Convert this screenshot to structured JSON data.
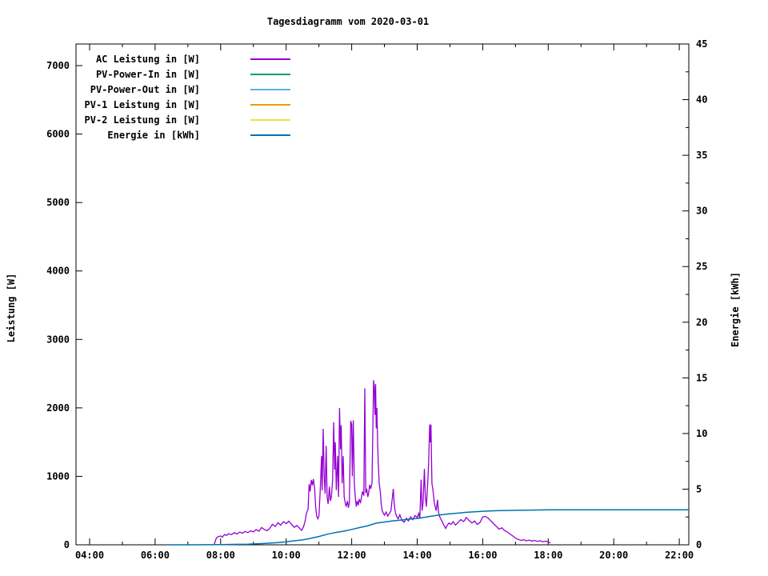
{
  "title": "Tagesdiagramm vom 2020-03-01",
  "colors": {
    "background": "#ffffff",
    "border": "#000000",
    "text": "#000000"
  },
  "axes": {
    "y_left": {
      "label": "Leistung [W]",
      "major": [
        {
          "v": 0,
          "label": "0"
        },
        {
          "v": 1000,
          "label": "1000"
        },
        {
          "v": 2000,
          "label": "2000"
        },
        {
          "v": 3000,
          "label": "3000"
        },
        {
          "v": 4000,
          "label": "4000"
        },
        {
          "v": 5000,
          "label": "5000"
        },
        {
          "v": 6000,
          "label": "6000"
        },
        {
          "v": 7000,
          "label": "7000"
        }
      ],
      "range": [
        0,
        7315
      ]
    },
    "y_right": {
      "label": "Energie [kWh]",
      "major": [
        {
          "v": 0,
          "label": "0"
        },
        {
          "v": 5,
          "label": "5"
        },
        {
          "v": 10,
          "label": "10"
        },
        {
          "v": 15,
          "label": "15"
        },
        {
          "v": 20,
          "label": "20"
        },
        {
          "v": 25,
          "label": "25"
        },
        {
          "v": 30,
          "label": "30"
        },
        {
          "v": 35,
          "label": "35"
        },
        {
          "v": 40,
          "label": "40"
        },
        {
          "v": 45,
          "label": "45"
        }
      ],
      "minor": [
        2.5,
        7.5,
        12.5,
        17.5,
        22.5,
        27.5,
        32.5,
        37.5,
        42.5
      ],
      "range": [
        0,
        45
      ]
    },
    "x": {
      "major": [
        {
          "h": 4,
          "label": "04:00"
        },
        {
          "h": 6,
          "label": "06:00"
        },
        {
          "h": 8,
          "label": "08:00"
        },
        {
          "h": 10,
          "label": "10:00"
        },
        {
          "h": 12,
          "label": "12:00"
        },
        {
          "h": 14,
          "label": "14:00"
        },
        {
          "h": 16,
          "label": "16:00"
        },
        {
          "h": 18,
          "label": "18:00"
        },
        {
          "h": 20,
          "label": "20:00"
        },
        {
          "h": 22,
          "label": "22:00"
        }
      ],
      "minor": [
        5,
        7,
        9,
        11,
        13,
        15,
        17,
        19,
        21
      ],
      "range_hours": [
        3.59,
        22.3
      ]
    }
  },
  "chart_data": {
    "type": "line",
    "title": "Tagesdiagramm vom 2020-03-01",
    "xlabel": "",
    "x_unit": "time of day (hours)",
    "legend_position": "top-left-inside",
    "grid": false,
    "series": [
      {
        "name": "AC Leistung in [W]",
        "color": "#9400d3",
        "axis": "left",
        "width": 1.3,
        "points": [
          [
            7.8,
            0
          ],
          [
            7.83,
            45
          ],
          [
            7.87,
            100
          ],
          [
            7.93,
            120
          ],
          [
            8.0,
            130
          ],
          [
            8.05,
            112
          ],
          [
            8.12,
            150
          ],
          [
            8.18,
            138
          ],
          [
            8.25,
            162
          ],
          [
            8.33,
            148
          ],
          [
            8.42,
            176
          ],
          [
            8.5,
            158
          ],
          [
            8.58,
            186
          ],
          [
            8.67,
            170
          ],
          [
            8.75,
            196
          ],
          [
            8.83,
            178
          ],
          [
            8.92,
            205
          ],
          [
            9.0,
            188
          ],
          [
            9.08,
            222
          ],
          [
            9.17,
            200
          ],
          [
            9.25,
            252
          ],
          [
            9.33,
            224
          ],
          [
            9.42,
            206
          ],
          [
            9.5,
            242
          ],
          [
            9.58,
            300
          ],
          [
            9.67,
            268
          ],
          [
            9.75,
            322
          ],
          [
            9.83,
            288
          ],
          [
            9.92,
            338
          ],
          [
            10.0,
            308
          ],
          [
            10.08,
            345
          ],
          [
            10.17,
            294
          ],
          [
            10.25,
            256
          ],
          [
            10.33,
            282
          ],
          [
            10.42,
            236
          ],
          [
            10.47,
            212
          ],
          [
            10.53,
            262
          ],
          [
            10.58,
            352
          ],
          [
            10.62,
            462
          ],
          [
            10.67,
            520
          ],
          [
            10.7,
            888
          ],
          [
            10.73,
            778
          ],
          [
            10.77,
            948
          ],
          [
            10.8,
            868
          ],
          [
            10.83,
            962
          ],
          [
            10.87,
            820
          ],
          [
            10.9,
            556
          ],
          [
            10.93,
            420
          ],
          [
            10.97,
            380
          ],
          [
            11.0,
            424
          ],
          [
            11.05,
            896
          ],
          [
            11.08,
            1296
          ],
          [
            11.1,
            796
          ],
          [
            11.13,
            1694
          ],
          [
            11.16,
            1002
          ],
          [
            11.19,
            748
          ],
          [
            11.22,
            1446
          ],
          [
            11.25,
            700
          ],
          [
            11.28,
            598
          ],
          [
            11.32,
            848
          ],
          [
            11.35,
            640
          ],
          [
            11.38,
            702
          ],
          [
            11.42,
            948
          ],
          [
            11.45,
            1790
          ],
          [
            11.48,
            1096
          ],
          [
            11.5,
            1498
          ],
          [
            11.53,
            798
          ],
          [
            11.57,
            1298
          ],
          [
            11.6,
            700
          ],
          [
            11.63,
            1998
          ],
          [
            11.66,
            1396
          ],
          [
            11.68,
            1748
          ],
          [
            11.71,
            898
          ],
          [
            11.74,
            1296
          ],
          [
            11.77,
            700
          ],
          [
            11.8,
            618
          ],
          [
            11.83,
            558
          ],
          [
            11.87,
            642
          ],
          [
            11.9,
            540
          ],
          [
            11.93,
            618
          ],
          [
            11.97,
            1810
          ],
          [
            12.0,
            1756
          ],
          [
            12.02,
            1000
          ],
          [
            12.05,
            1818
          ],
          [
            12.08,
            896
          ],
          [
            12.11,
            700
          ],
          [
            12.14,
            558
          ],
          [
            12.17,
            640
          ],
          [
            12.2,
            578
          ],
          [
            12.23,
            660
          ],
          [
            12.27,
            618
          ],
          [
            12.3,
            700
          ],
          [
            12.33,
            778
          ],
          [
            12.37,
            718
          ],
          [
            12.4,
            2286
          ],
          [
            12.43,
            758
          ],
          [
            12.46,
            820
          ],
          [
            12.49,
            700
          ],
          [
            12.52,
            758
          ],
          [
            12.55,
            878
          ],
          [
            12.58,
            818
          ],
          [
            12.62,
            898
          ],
          [
            12.65,
            1798
          ],
          [
            12.67,
            2404
          ],
          [
            12.69,
            2300
          ],
          [
            12.71,
            1898
          ],
          [
            12.73,
            2348
          ],
          [
            12.75,
            1700
          ],
          [
            12.77,
            1998
          ],
          [
            12.79,
            1498
          ],
          [
            12.81,
            1196
          ],
          [
            12.84,
            898
          ],
          [
            12.87,
            798
          ],
          [
            12.9,
            598
          ],
          [
            12.93,
            498
          ],
          [
            12.97,
            458
          ],
          [
            13.0,
            432
          ],
          [
            13.05,
            478
          ],
          [
            13.1,
            420
          ],
          [
            13.15,
            458
          ],
          [
            13.2,
            498
          ],
          [
            13.27,
            816
          ],
          [
            13.3,
            598
          ],
          [
            13.33,
            478
          ],
          [
            13.37,
            420
          ],
          [
            13.42,
            380
          ],
          [
            13.47,
            438
          ],
          [
            13.53,
            358
          ],
          [
            13.6,
            330
          ],
          [
            13.67,
            388
          ],
          [
            13.73,
            348
          ],
          [
            13.8,
            408
          ],
          [
            13.87,
            368
          ],
          [
            13.93,
            428
          ],
          [
            14.0,
            398
          ],
          [
            14.05,
            458
          ],
          [
            14.08,
            380
          ],
          [
            14.12,
            952
          ],
          [
            14.15,
            498
          ],
          [
            14.18,
            618
          ],
          [
            14.22,
            1108
          ],
          [
            14.25,
            700
          ],
          [
            14.28,
            558
          ],
          [
            14.32,
            898
          ],
          [
            14.35,
            1198
          ],
          [
            14.38,
            1758
          ],
          [
            14.4,
            1498
          ],
          [
            14.42,
            1756
          ],
          [
            14.45,
            898
          ],
          [
            14.48,
            798
          ],
          [
            14.52,
            618
          ],
          [
            14.55,
            558
          ],
          [
            14.58,
            498
          ],
          [
            14.62,
            658
          ],
          [
            14.65,
            478
          ],
          [
            14.68,
            420
          ],
          [
            14.72,
            378
          ],
          [
            14.77,
            330
          ],
          [
            14.82,
            280
          ],
          [
            14.87,
            240
          ],
          [
            14.92,
            288
          ],
          [
            14.97,
            318
          ],
          [
            15.03,
            298
          ],
          [
            15.1,
            338
          ],
          [
            15.17,
            288
          ],
          [
            15.25,
            328
          ],
          [
            15.33,
            368
          ],
          [
            15.42,
            338
          ],
          [
            15.5,
            398
          ],
          [
            15.58,
            358
          ],
          [
            15.67,
            318
          ],
          [
            15.75,
            348
          ],
          [
            15.83,
            298
          ],
          [
            15.92,
            328
          ],
          [
            16.0,
            408
          ],
          [
            16.08,
            415
          ],
          [
            16.17,
            388
          ],
          [
            16.25,
            348
          ],
          [
            16.33,
            308
          ],
          [
            16.42,
            268
          ],
          [
            16.5,
            228
          ],
          [
            16.58,
            248
          ],
          [
            16.67,
            208
          ],
          [
            16.75,
            188
          ],
          [
            16.83,
            158
          ],
          [
            16.92,
            128
          ],
          [
            17.0,
            98
          ],
          [
            17.08,
            78
          ],
          [
            17.17,
            64
          ],
          [
            17.25,
            74
          ],
          [
            17.33,
            58
          ],
          [
            17.42,
            70
          ],
          [
            17.5,
            54
          ],
          [
            17.58,
            64
          ],
          [
            17.67,
            50
          ],
          [
            17.75,
            60
          ],
          [
            17.83,
            44
          ],
          [
            17.92,
            54
          ],
          [
            18.0,
            40
          ],
          [
            18.07,
            28
          ]
        ]
      },
      {
        "name": "PV-Power-In in [W]",
        "color": "#009e73",
        "axis": "left",
        "width": 1.3,
        "points": []
      },
      {
        "name": "PV-Power-Out in [W]",
        "color": "#56b4e9",
        "axis": "left",
        "width": 1.3,
        "points": []
      },
      {
        "name": "PV-1 Leistung in [W]",
        "color": "#e69f00",
        "axis": "left",
        "width": 1.3,
        "points": []
      },
      {
        "name": "PV-2 Leistung in [W]",
        "color": "#f0e442",
        "axis": "left",
        "width": 1.3,
        "points": []
      },
      {
        "name": "Energie in [kWh]",
        "color": "#0072b2",
        "axis": "right",
        "width": 1.5,
        "points": [
          [
            6.4,
            0
          ],
          [
            7.0,
            0
          ],
          [
            7.5,
            0.01
          ],
          [
            8.0,
            0.02
          ],
          [
            8.5,
            0.04
          ],
          [
            8.83,
            0.06
          ],
          [
            9.0,
            0.08
          ],
          [
            9.25,
            0.11
          ],
          [
            9.5,
            0.15
          ],
          [
            9.75,
            0.2
          ],
          [
            10.0,
            0.27
          ],
          [
            10.25,
            0.36
          ],
          [
            10.5,
            0.44
          ],
          [
            10.75,
            0.58
          ],
          [
            11.0,
            0.75
          ],
          [
            11.25,
            0.95
          ],
          [
            11.5,
            1.1
          ],
          [
            11.75,
            1.22
          ],
          [
            12.0,
            1.38
          ],
          [
            12.25,
            1.55
          ],
          [
            12.5,
            1.72
          ],
          [
            12.75,
            1.95
          ],
          [
            13.0,
            2.05
          ],
          [
            13.25,
            2.15
          ],
          [
            13.5,
            2.22
          ],
          [
            13.75,
            2.3
          ],
          [
            14.0,
            2.37
          ],
          [
            14.25,
            2.48
          ],
          [
            14.5,
            2.6
          ],
          [
            14.75,
            2.7
          ],
          [
            15.0,
            2.78
          ],
          [
            15.25,
            2.85
          ],
          [
            15.5,
            2.92
          ],
          [
            15.75,
            2.97
          ],
          [
            16.0,
            3.01
          ],
          [
            16.25,
            3.05
          ],
          [
            16.5,
            3.07
          ],
          [
            17.0,
            3.1
          ],
          [
            17.5,
            3.12
          ],
          [
            18.0,
            3.14
          ],
          [
            18.5,
            3.15
          ],
          [
            22.29,
            3.15
          ]
        ]
      }
    ]
  }
}
